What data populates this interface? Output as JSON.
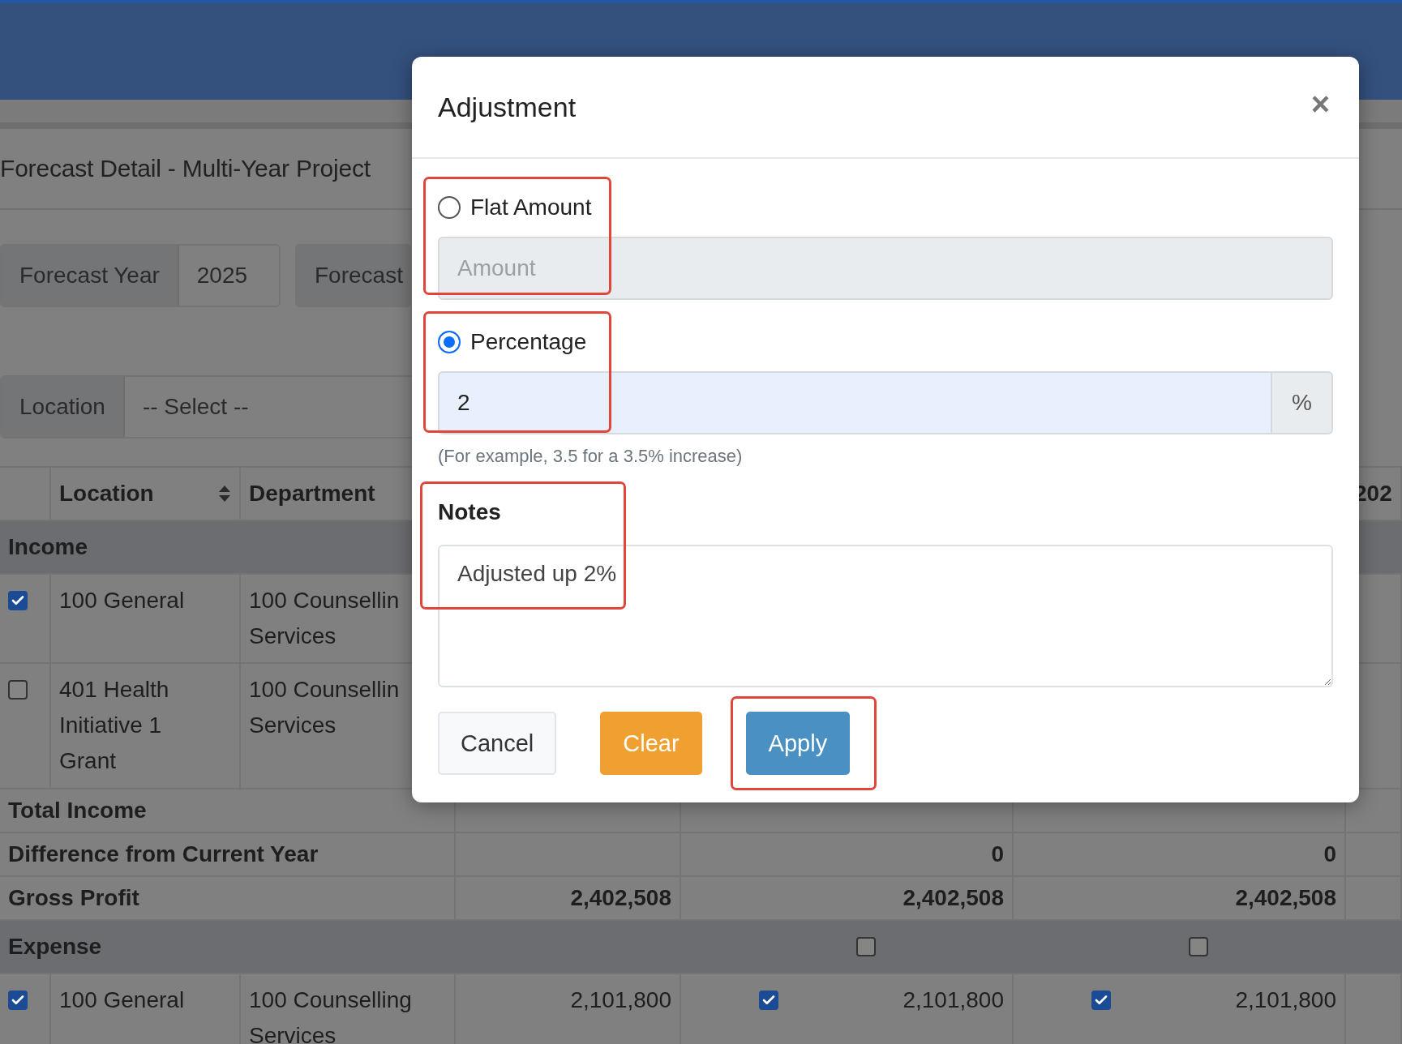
{
  "page": {
    "title": "Forecast Detail - Multi-Year Project",
    "filters": [
      {
        "label": "Forecast Year",
        "value": "2025"
      },
      {
        "label": "Forecast"
      }
    ],
    "location_filter": {
      "label": "Location",
      "value": "-- Select --"
    }
  },
  "table": {
    "columns": [
      {
        "label": "Location",
        "sortable": true
      },
      {
        "label": "Department"
      },
      {
        "label": "202"
      }
    ],
    "rows": [
      {
        "kind": "group",
        "label": "Income"
      },
      {
        "kind": "item",
        "checked": true,
        "location": "100 General",
        "department": "100 Counsellin Services"
      },
      {
        "kind": "item",
        "checked": false,
        "location": "401 Health Initiative 1 Grant",
        "department": "100 Counsellin Services"
      },
      {
        "kind": "total",
        "label": "Total Income"
      },
      {
        "kind": "total",
        "label": "Difference from Current Year",
        "values": {
          "column_2": "0",
          "column_3": "0"
        }
      },
      {
        "kind": "total",
        "label": "Gross Profit",
        "values": {
          "column_1": "2,402,508",
          "column_2": "2,402,508",
          "column_3": "2,402,508"
        }
      },
      {
        "kind": "group",
        "label": "Expense",
        "checks": {
          "column_2": false,
          "column_3": false
        }
      },
      {
        "kind": "item",
        "checked": true,
        "location": "100 General",
        "department": "100 Counselling Services",
        "values": {
          "column_1": {
            "value": "2,101,800"
          },
          "column_2": {
            "value": "2,101,800",
            "checked": true
          },
          "column_3": {
            "value": "2,101,800",
            "checked": true
          }
        }
      }
    ]
  },
  "modal": {
    "title": "Adjustment",
    "close": "×",
    "options": [
      {
        "label": "Flat Amount",
        "selected": false,
        "highlighted": true,
        "placeholder": "Amount"
      },
      {
        "label": "Percentage",
        "selected": true,
        "highlighted": true,
        "value": "2",
        "suffix": "%"
      }
    ],
    "hint": "(For example, 3.5 for a 3.5% increase)",
    "notes": {
      "label": "Notes",
      "value": "Adjusted up 2%",
      "highlighted": true
    },
    "buttons": [
      {
        "label": "Cancel",
        "kind": "secondary"
      },
      {
        "label": "Clear",
        "kind": "warning"
      },
      {
        "label": "Apply",
        "kind": "primary",
        "highlighted": true
      }
    ]
  }
}
